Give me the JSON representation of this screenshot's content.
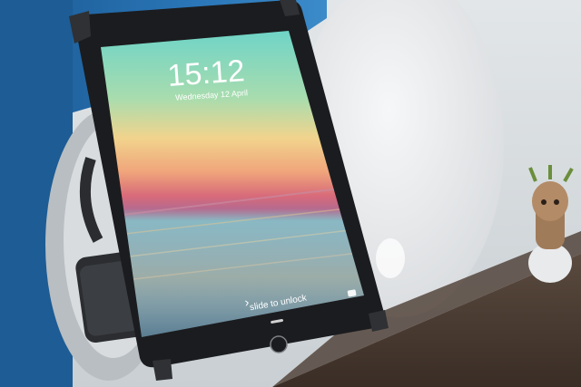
{
  "lockscreen": {
    "time": "15:12",
    "date": "Wednesday 12 April",
    "unlock_hint": "slide to unlock",
    "unlock_arrow": "›"
  },
  "icons": {
    "home_button": "home-button-icon",
    "camera": "camera-icon",
    "lock_indicator": "lock-icon"
  },
  "colors": {
    "wall_blue": "#1f5f96",
    "sky_top": "#6fd0c9",
    "horizon_pink": "#d86a78",
    "sea": "#7aa8b4",
    "tablet_frame": "#1b1c1f",
    "felt_speaker": "#e7e8ea"
  }
}
